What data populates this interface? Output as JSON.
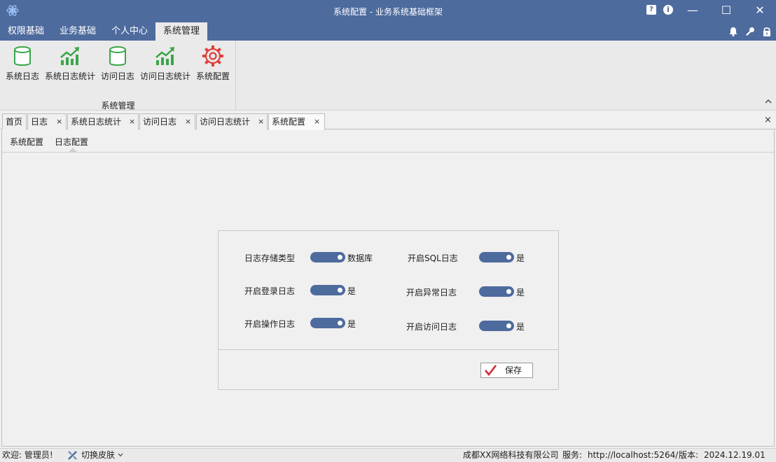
{
  "window": {
    "title": "系统配置 - 业务系统基础框架",
    "min_glyph": "—",
    "max_glyph": "☐",
    "close_glyph": "✕",
    "help_glyph": "?",
    "info_glyph": "i"
  },
  "menu": {
    "tabs": [
      {
        "label": "权限基础"
      },
      {
        "label": "业务基础"
      },
      {
        "label": "个人中心"
      },
      {
        "label": "系统管理",
        "active": true
      }
    ],
    "right_icons": [
      "bell-icon",
      "key-icon",
      "lock-icon"
    ]
  },
  "ribbon": {
    "group_label": "系统管理",
    "buttons": [
      {
        "label": "系统日志",
        "icon": "database-icon"
      },
      {
        "label": "系统日志统计",
        "icon": "growth-chart-icon"
      },
      {
        "label": "访问日志",
        "icon": "database-icon"
      },
      {
        "label": "访问日志统计",
        "icon": "growth-chart-icon"
      },
      {
        "label": "系统配置",
        "icon": "gear-icon"
      }
    ]
  },
  "doc_tabs": [
    {
      "label": "首页",
      "closable": false
    },
    {
      "label": "日志",
      "closable": true
    },
    {
      "label": "系统日志统计",
      "closable": true
    },
    {
      "label": "访问日志",
      "closable": true
    },
    {
      "label": "访问日志统计",
      "closable": true
    },
    {
      "label": "系统配置",
      "closable": true,
      "active": true
    }
  ],
  "close_glyph": "×",
  "sub_tabs": [
    {
      "label": "系统配置"
    },
    {
      "label": "日志配置",
      "active": true
    }
  ],
  "log_config": {
    "left": [
      {
        "label": "日志存储类型",
        "value": "数据库",
        "on": true
      },
      {
        "label": "开启登录日志",
        "value": "是",
        "on": true
      },
      {
        "label": "开启操作日志",
        "value": "是",
        "on": true
      }
    ],
    "right": [
      {
        "label": "开启SQL日志",
        "value": "是",
        "on": true
      },
      {
        "label": "开启异常日志",
        "value": "是",
        "on": true
      },
      {
        "label": "开启访问日志",
        "value": "是",
        "on": true
      }
    ],
    "save_label": "保存"
  },
  "status": {
    "welcome": "欢迎: 管理员!",
    "skin": "切换皮肤",
    "company": "成都XX网络科技有限公司",
    "service_label": "服务:",
    "service_url": "http://localhost:5264/",
    "version_label": "版本:",
    "version": "2024.12.19.01"
  },
  "colors": {
    "accent": "#4e6b9e",
    "chart_green": "#3aa64a",
    "gear_red": "#e0403a"
  }
}
